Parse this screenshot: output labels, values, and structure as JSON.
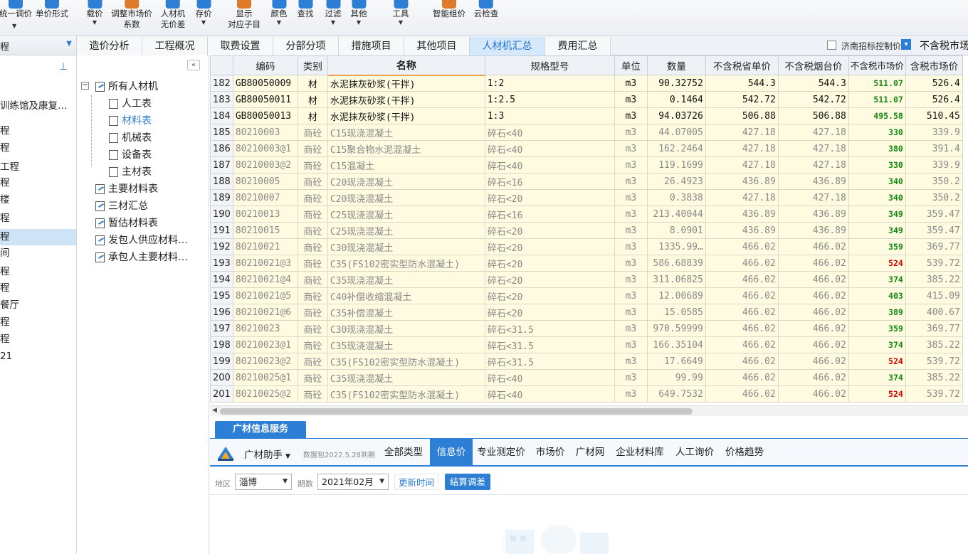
{
  "toolbar": {
    "buttons": [
      {
        "label": "统一调价",
        "label2": "",
        "caret": false
      },
      {
        "label": "单价形式",
        "label2": "",
        "caret": false
      },
      {
        "label": "载价",
        "label2": "",
        "caret": true
      },
      {
        "label": "调整市场价",
        "label2": "系数",
        "caret": false
      },
      {
        "label": "人材机",
        "label2": "无价差",
        "caret": false
      },
      {
        "label": "存价",
        "label2": "",
        "caret": true
      },
      {
        "label": "显示",
        "label2": "对应子目",
        "caret": false
      },
      {
        "label": "颜色",
        "label2": "",
        "caret": true
      },
      {
        "label": "查找",
        "label2": "",
        "caret": false
      },
      {
        "label": "过滤",
        "label2": "",
        "caret": true
      },
      {
        "label": "其他",
        "label2": "",
        "caret": true
      },
      {
        "label": "工具",
        "label2": "",
        "caret": true
      },
      {
        "label": "智能组价",
        "label2": "",
        "caret": false
      },
      {
        "label": "云检查",
        "label2": "",
        "caret": false
      }
    ]
  },
  "left_strip": {
    "head_text": "程",
    "items": [
      "训练馆及康复…",
      "程",
      "程",
      "工程",
      "程",
      "楼",
      "程",
      "程",
      "间",
      "程",
      "程",
      "餐厅",
      "程",
      "程",
      "21"
    ],
    "selected_index": 7
  },
  "tabs": {
    "items": [
      "造价分析",
      "工程概况",
      "取费设置",
      "分部分项",
      "措施项目",
      "其他项目",
      "人材机汇总",
      "费用汇总"
    ],
    "active_index": 6,
    "checkbox_label": "济南招标控制价",
    "notax_label": "不含税市场"
  },
  "tree": {
    "nodes": [
      {
        "label": "所有人材机",
        "level": 0,
        "folder": true
      },
      {
        "label": "人工表",
        "level": 1,
        "folder": false
      },
      {
        "label": "材料表",
        "level": 1,
        "folder": false,
        "selected": true
      },
      {
        "label": "机械表",
        "level": 1,
        "folder": false
      },
      {
        "label": "设备表",
        "level": 1,
        "folder": false
      },
      {
        "label": "主材表",
        "level": 1,
        "folder": false
      },
      {
        "label": "主要材料表",
        "level": 0,
        "folder": true
      },
      {
        "label": "三材汇总",
        "level": 0,
        "folder": true
      },
      {
        "label": "暂估材料表",
        "level": 0,
        "folder": true
      },
      {
        "label": "发包人供应材料…",
        "level": 0,
        "folder": true
      },
      {
        "label": "承包人主要材料…",
        "level": 0,
        "folder": true
      }
    ]
  },
  "grid": {
    "columns": [
      "",
      "编码",
      "类别",
      "名称",
      "规格型号",
      "单位",
      "数量",
      "不含税省单价",
      "不含税烟台价",
      "不含税市场价",
      "含税市场价"
    ],
    "rows": [
      {
        "n": "182",
        "code": "GB80050009",
        "type": "材",
        "name": "水泥抹灰砂浆(干拌)",
        "spec": "1:2",
        "unit": "m3",
        "qty": "90.32752",
        "p1": "544.3",
        "p2": "544.3",
        "mkt": "511.07",
        "mktColor": "#138a13",
        "tax": "526.4",
        "style": "main"
      },
      {
        "n": "183",
        "code": "GB80050011",
        "type": "材",
        "name": "水泥抹灰砂浆(干拌)",
        "spec": "1:2.5",
        "unit": "m3",
        "qty": "0.1464",
        "p1": "542.72",
        "p2": "542.72",
        "mkt": "511.07",
        "mktColor": "#138a13",
        "tax": "526.4",
        "style": "main"
      },
      {
        "n": "184",
        "code": "GB80050013",
        "type": "材",
        "name": "水泥抹灰砂浆(干拌)",
        "spec": "1:3",
        "unit": "m3",
        "qty": "94.03726",
        "p1": "506.88",
        "p2": "506.88",
        "mkt": "495.58",
        "mktColor": "#138a13",
        "tax": "510.45",
        "style": "main"
      },
      {
        "n": "185",
        "code": "80210003",
        "type": "商砼",
        "name": "C15现浇混凝土",
        "spec": "碎石<40",
        "unit": "m3",
        "qty": "44.07005",
        "p1": "427.18",
        "p2": "427.18",
        "mkt": "330",
        "mktColor": "#138a13",
        "tax": "339.9",
        "style": "dim"
      },
      {
        "n": "186",
        "code": "80210003@1",
        "type": "商砼",
        "name": "C15聚合物水泥混凝土",
        "spec": "碎石<40",
        "unit": "m3",
        "qty": "162.2464",
        "p1": "427.18",
        "p2": "427.18",
        "mkt": "380",
        "mktColor": "#138a13",
        "tax": "391.4",
        "style": "dim"
      },
      {
        "n": "187",
        "code": "80210003@2",
        "type": "商砼",
        "name": "C15混凝土",
        "spec": "碎石<40",
        "unit": "m3",
        "qty": "119.1699",
        "p1": "427.18",
        "p2": "427.18",
        "mkt": "330",
        "mktColor": "#138a13",
        "tax": "339.9",
        "style": "dim"
      },
      {
        "n": "188",
        "code": "80210005",
        "type": "商砼",
        "name": "C20现浇混凝土",
        "spec": "碎石<16",
        "unit": "m3",
        "qty": "26.4923",
        "p1": "436.89",
        "p2": "436.89",
        "mkt": "340",
        "mktColor": "#138a13",
        "tax": "350.2",
        "style": "dim"
      },
      {
        "n": "189",
        "code": "80210007",
        "type": "商砼",
        "name": "C20现浇混凝土",
        "spec": "碎石<20",
        "unit": "m3",
        "qty": "0.3838",
        "p1": "427.18",
        "p2": "427.18",
        "mkt": "340",
        "mktColor": "#138a13",
        "tax": "350.2",
        "style": "dim"
      },
      {
        "n": "190",
        "code": "80210013",
        "type": "商砼",
        "name": "C25现浇混凝土",
        "spec": "碎石<16",
        "unit": "m3",
        "qty": "213.40044",
        "p1": "436.89",
        "p2": "436.89",
        "mkt": "349",
        "mktColor": "#138a13",
        "tax": "359.47",
        "style": "dim"
      },
      {
        "n": "191",
        "code": "80210015",
        "type": "商砼",
        "name": "C25现浇混凝土",
        "spec": "碎石<20",
        "unit": "m3",
        "qty": "8.0901",
        "p1": "436.89",
        "p2": "436.89",
        "mkt": "349",
        "mktColor": "#138a13",
        "tax": "359.47",
        "style": "dim"
      },
      {
        "n": "192",
        "code": "80210021",
        "type": "商砼",
        "name": "C30现浇混凝土",
        "spec": "碎石<20",
        "unit": "m3",
        "qty": "1335.99…",
        "p1": "466.02",
        "p2": "466.02",
        "mkt": "359",
        "mktColor": "#138a13",
        "tax": "369.77",
        "style": "dim"
      },
      {
        "n": "193",
        "code": "80210021@3",
        "type": "商砼",
        "name": "C35(FS102密实型防水混凝土)",
        "spec": "碎石<20",
        "unit": "m3",
        "qty": "586.68839",
        "p1": "466.02",
        "p2": "466.02",
        "mkt": "524",
        "mktColor": "#d40000",
        "tax": "539.72",
        "style": "dim"
      },
      {
        "n": "194",
        "code": "80210021@4",
        "type": "商砼",
        "name": "C35现浇混凝土",
        "spec": "碎石<20",
        "unit": "m3",
        "qty": "311.06825",
        "p1": "466.02",
        "p2": "466.02",
        "mkt": "374",
        "mktColor": "#138a13",
        "tax": "385.22",
        "style": "dim"
      },
      {
        "n": "195",
        "code": "80210021@5",
        "type": "商砼",
        "name": "C40补偿收缩混凝土",
        "spec": "碎石<20",
        "unit": "m3",
        "qty": "12.00689",
        "p1": "466.02",
        "p2": "466.02",
        "mkt": "403",
        "mktColor": "#138a13",
        "tax": "415.09",
        "style": "dim"
      },
      {
        "n": "196",
        "code": "80210021@6",
        "type": "商砼",
        "name": "C35补偿混凝土",
        "spec": "碎石<20",
        "unit": "m3",
        "qty": "15.0585",
        "p1": "466.02",
        "p2": "466.02",
        "mkt": "389",
        "mktColor": "#138a13",
        "tax": "400.67",
        "style": "dim"
      },
      {
        "n": "197",
        "code": "80210023",
        "type": "商砼",
        "name": "C30现浇混凝土",
        "spec": "碎石<31.5",
        "unit": "m3",
        "qty": "970.59999",
        "p1": "466.02",
        "p2": "466.02",
        "mkt": "359",
        "mktColor": "#138a13",
        "tax": "369.77",
        "style": "dim"
      },
      {
        "n": "198",
        "code": "80210023@1",
        "type": "商砼",
        "name": "C35现浇混凝土",
        "spec": "碎石<31.5",
        "unit": "m3",
        "qty": "166.35104",
        "p1": "466.02",
        "p2": "466.02",
        "mkt": "374",
        "mktColor": "#138a13",
        "tax": "385.22",
        "style": "dim"
      },
      {
        "n": "199",
        "code": "80210023@2",
        "type": "商砼",
        "name": "C35(FS102密实型防水混凝土)",
        "spec": "碎石<31.5",
        "unit": "m3",
        "qty": "17.6649",
        "p1": "466.02",
        "p2": "466.02",
        "mkt": "524",
        "mktColor": "#d40000",
        "tax": "539.72",
        "style": "dim"
      },
      {
        "n": "200",
        "code": "80210025@1",
        "type": "商砼",
        "name": "C35现浇混凝土",
        "spec": "碎石<40",
        "unit": "m3",
        "qty": "99.99",
        "p1": "466.02",
        "p2": "466.02",
        "mkt": "374",
        "mktColor": "#138a13",
        "tax": "385.22",
        "style": "dim"
      },
      {
        "n": "201",
        "code": "80210025@2",
        "type": "商砼",
        "name": "C35(FS102密实型防水混凝土)",
        "spec": "碎石<40",
        "unit": "m3",
        "qty": "649.7532",
        "p1": "466.02",
        "p2": "466.02",
        "mkt": "524",
        "mktColor": "#d40000",
        "tax": "539.72",
        "style": "dim"
      }
    ]
  },
  "info": {
    "service_tab": "广材信息服务",
    "assistant_label": "广材助手",
    "package_date": "数据包2022.5.28到期",
    "source_tabs": [
      "全部类型",
      "信息价",
      "专业测定价",
      "市场价",
      "广材网",
      "企业材料库",
      "人工询价",
      "价格趋势"
    ],
    "active_source_index": 1,
    "region_label": "地区",
    "region_value": "淄博",
    "period_label": "期数",
    "period_value": "2021年02月",
    "refresh_button": "更新时间",
    "settle_button": "结算调差"
  },
  "colors": {
    "accent": "#2d7fd6",
    "cell_bg": "#fffbe0",
    "market_green": "#138a13",
    "market_red": "#d40000"
  }
}
